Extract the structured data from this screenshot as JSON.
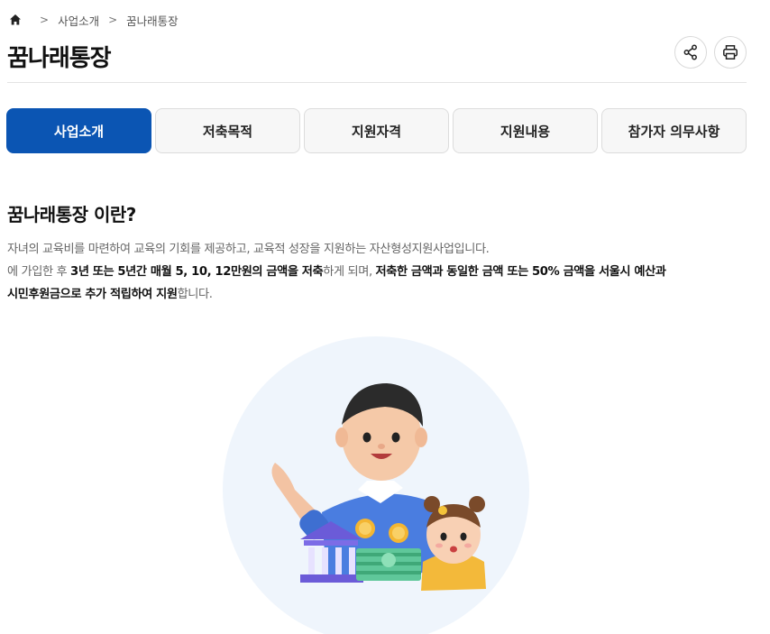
{
  "breadcrumb": {
    "items": [
      "사업소개",
      "꿈나래통장"
    ]
  },
  "page": {
    "title": "꿈나래통장"
  },
  "actions": {
    "share_icon": "share-icon",
    "print_icon": "print-icon"
  },
  "tabs": [
    {
      "label": "사업소개",
      "active": true
    },
    {
      "label": "저축목적",
      "active": false
    },
    {
      "label": "지원자격",
      "active": false
    },
    {
      "label": "지원내용",
      "active": false
    },
    {
      "label": "참가자 의무사항",
      "active": false
    }
  ],
  "intro": {
    "heading": "꿈나래통장 이란?",
    "line1": "자녀의 교육비를 마련하여 교육의 기회를 제공하고, 교육적 성장을 지원하는 자산형성지원사업입니다.",
    "line2_a": "에 가입한 후 ",
    "line2_b": "3년 또는 5년간 매월 5, 10, 12만원의 금액을 저축",
    "line2_c": "하게 되며, ",
    "line2_d": "저축한 금액과 동일한 금액 또는 50% 금액을 서울시 예산과",
    "line3_a": "시민후원금으로 추가 적립하여 지원",
    "line3_b": "합니다."
  },
  "colors": {
    "accent": "#0b55b3",
    "tab_bg": "#f7f7f7",
    "illustration_bg": "#eff5fc"
  }
}
